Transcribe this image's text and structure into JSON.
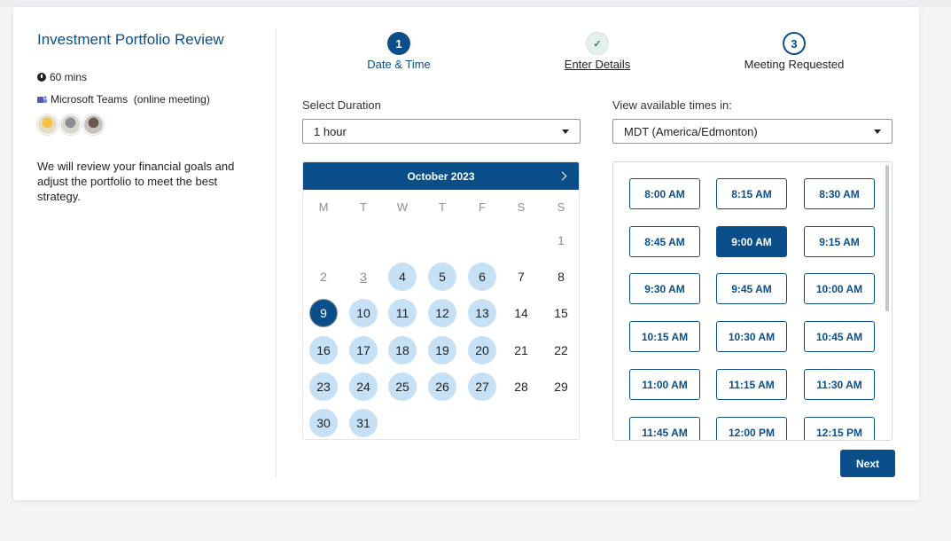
{
  "event": {
    "title": "Investment Portfolio Review",
    "duration": "60 mins",
    "location": "Microsoft Teams  (online meeting)",
    "description": "We will review your financial goals and adjust the portfolio to meet the best strategy."
  },
  "stepper": [
    {
      "number": "1",
      "label": "Date & Time",
      "state": "current"
    },
    {
      "number": "✓",
      "label": "Enter Details",
      "state": "done"
    },
    {
      "number": "3",
      "label": "Meeting Requested",
      "state": "upcoming"
    }
  ],
  "duration_select": {
    "label": "Select Duration",
    "value": "1 hour"
  },
  "timezone_select": {
    "label": "View available times in:",
    "value": "MDT (America/Edmonton)"
  },
  "calendar": {
    "month": "October 2023",
    "weekdays": [
      "M",
      "T",
      "W",
      "T",
      "F",
      "S",
      "S"
    ],
    "weeks": [
      [
        null,
        null,
        null,
        null,
        null,
        null,
        {
          "d": "1",
          "s": "past"
        }
      ],
      [
        {
          "d": "2",
          "s": "past"
        },
        {
          "d": "3",
          "s": "today"
        },
        {
          "d": "4",
          "s": "avail"
        },
        {
          "d": "5",
          "s": "avail"
        },
        {
          "d": "6",
          "s": "avail"
        },
        {
          "d": "7",
          "s": "plain"
        },
        {
          "d": "8",
          "s": "plain"
        }
      ],
      [
        {
          "d": "9",
          "s": "sel"
        },
        {
          "d": "10",
          "s": "avail"
        },
        {
          "d": "11",
          "s": "avail"
        },
        {
          "d": "12",
          "s": "avail"
        },
        {
          "d": "13",
          "s": "avail"
        },
        {
          "d": "14",
          "s": "plain"
        },
        {
          "d": "15",
          "s": "plain"
        }
      ],
      [
        {
          "d": "16",
          "s": "avail"
        },
        {
          "d": "17",
          "s": "avail"
        },
        {
          "d": "18",
          "s": "avail"
        },
        {
          "d": "19",
          "s": "avail"
        },
        {
          "d": "20",
          "s": "avail"
        },
        {
          "d": "21",
          "s": "plain"
        },
        {
          "d": "22",
          "s": "plain"
        }
      ],
      [
        {
          "d": "23",
          "s": "avail"
        },
        {
          "d": "24",
          "s": "avail"
        },
        {
          "d": "25",
          "s": "avail"
        },
        {
          "d": "26",
          "s": "avail"
        },
        {
          "d": "27",
          "s": "avail"
        },
        {
          "d": "28",
          "s": "plain"
        },
        {
          "d": "29",
          "s": "plain"
        }
      ],
      [
        {
          "d": "30",
          "s": "avail"
        },
        {
          "d": "31",
          "s": "avail"
        },
        null,
        null,
        null,
        null,
        null
      ]
    ]
  },
  "times": {
    "slots": [
      "8:00 AM",
      "8:15 AM",
      "8:30 AM",
      "8:45 AM",
      "9:00 AM",
      "9:15 AM",
      "9:30 AM",
      "9:45 AM",
      "10:00 AM",
      "10:15 AM",
      "10:30 AM",
      "10:45 AM",
      "11:00 AM",
      "11:15 AM",
      "11:30 AM",
      "11:45 AM",
      "12:00 PM",
      "12:15 PM"
    ],
    "selected": "9:00 AM"
  },
  "next_label": "Next",
  "colors": {
    "primary": "#0b4f8a",
    "available": "#c6e0f5",
    "done": "#e3f1ea"
  }
}
